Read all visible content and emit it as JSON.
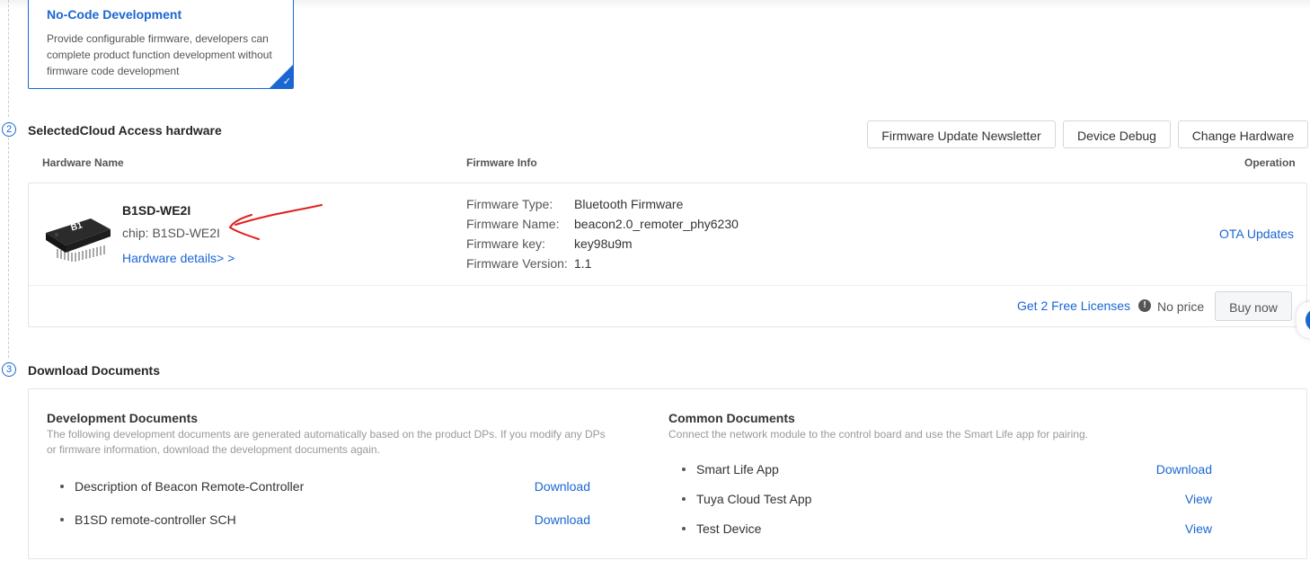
{
  "nocode": {
    "title": "No-Code Development",
    "desc": "Provide configurable firmware, developers can complete product function development without firmware code development"
  },
  "steps": {
    "s2": "2",
    "s3": "3"
  },
  "hardware_section": {
    "title": "SelectedCloud Access hardware",
    "buttons": {
      "newsletter": "Firmware Update Newsletter",
      "debug": "Device Debug",
      "change": "Change Hardware"
    },
    "headers": {
      "name": "Hardware Name",
      "firmware": "Firmware Info",
      "operation": "Operation"
    },
    "hardware": {
      "name": "B1SD-WE2I",
      "chip": "chip: B1SD-WE2I",
      "details_link": "Hardware details> >",
      "chip_label": "B1"
    },
    "firmware": {
      "type_label": "Firmware Type:",
      "type_value": "Bluetooth Firmware",
      "name_label": "Firmware Name:",
      "name_value": "beacon2.0_remoter_phy6230",
      "key_label": "Firmware key:",
      "key_value": "key98u9m",
      "version_label": "Firmware Version:",
      "version_value": "1.1"
    },
    "operation_link": "OTA Updates",
    "licenses_link": "Get 2 Free Licenses",
    "price": "No price",
    "buy_button": "Buy now"
  },
  "download_section": {
    "title": "Download Documents",
    "dev": {
      "title": "Development Documents",
      "subtitle": "The following development documents are generated automatically based on the product DPs. If you modify any DPs or firmware information, download the development documents again.",
      "items": [
        {
          "label": "Description of Beacon Remote-Controller",
          "action": "Download"
        },
        {
          "label": "B1SD remote-controller SCH",
          "action": "Download"
        }
      ]
    },
    "common": {
      "title": "Common Documents",
      "subtitle": "Connect the network module to the control board and use the Smart Life app for pairing.",
      "items": [
        {
          "label": "Smart Life App",
          "action": "Download"
        },
        {
          "label": "Tuya Cloud Test App",
          "action": "View"
        },
        {
          "label": "Test Device",
          "action": "View"
        }
      ]
    }
  },
  "colors": {
    "accent": "#1a66d2",
    "annotation": "#e0201c"
  }
}
